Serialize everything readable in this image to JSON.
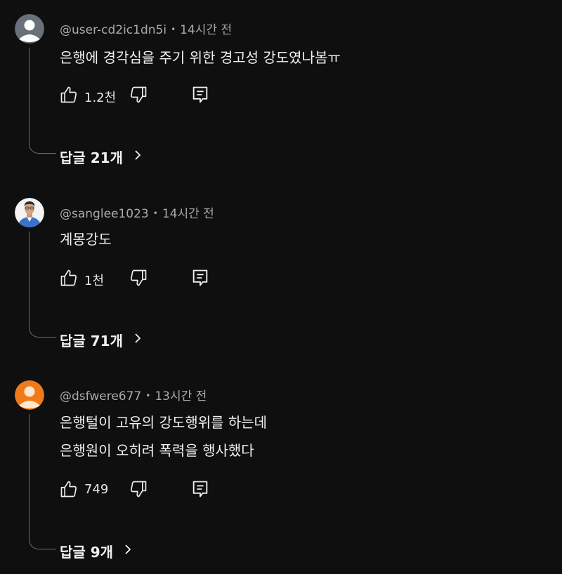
{
  "comments": [
    {
      "user": "@user-cd2ic1dn5i",
      "time": "14시간 전",
      "lines": [
        "은행에 경각심을 주기 위한 경고성 강도였나봄ㅠ"
      ],
      "likes": "1.2천",
      "replies": "답글 21개",
      "avatar": "default-avatar"
    },
    {
      "user": "@sanglee1023",
      "time": "14시간 전",
      "lines": [
        "계몽강도"
      ],
      "likes": "1천",
      "replies": "답글 71개",
      "avatar": "photo-avatar"
    },
    {
      "user": "@dsfwere677",
      "time": "13시간 전",
      "lines": [
        "은행털이 고유의 강도행위를 하는데",
        "은행원이 오히려 폭력을 행사했다"
      ],
      "likes": "749",
      "replies": "답글 9개",
      "avatar": "default-avatar-orange"
    }
  ],
  "separator": "•",
  "colors": {
    "background": "#0f0f0f",
    "text": "#f1f1f1",
    "meta": "#aaaaaa",
    "avatar_gray": "#6a7079",
    "avatar_orange": "#f07a1a"
  },
  "icons": {
    "like": "thumb-up-icon",
    "dislike": "thumb-down-icon",
    "reply": "comment-icon",
    "expand": "chevron-right-icon"
  }
}
